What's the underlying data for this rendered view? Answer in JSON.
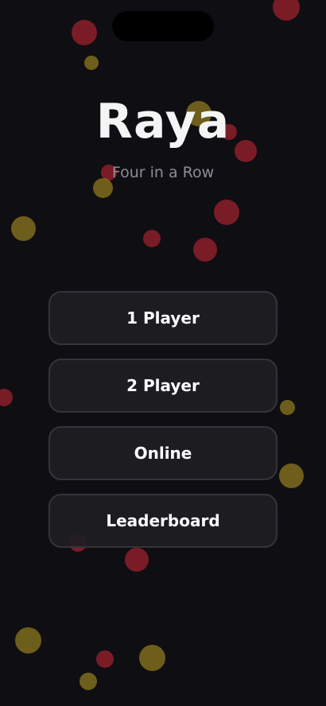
{
  "app": {
    "title": "Raya",
    "subtitle": "Four in a Row"
  },
  "menu": {
    "buttons": [
      {
        "label": "1 Player"
      },
      {
        "label": "2 Player"
      },
      {
        "label": "Online"
      },
      {
        "label": "Leaderboard"
      }
    ]
  },
  "colors": {
    "background": "#0f0e12",
    "button_bg": "#1e1d23",
    "button_border": "#35343b",
    "subtitle": "#8e8c96",
    "disc_red": "#d22837",
    "disc_yellow": "#bea023"
  }
}
